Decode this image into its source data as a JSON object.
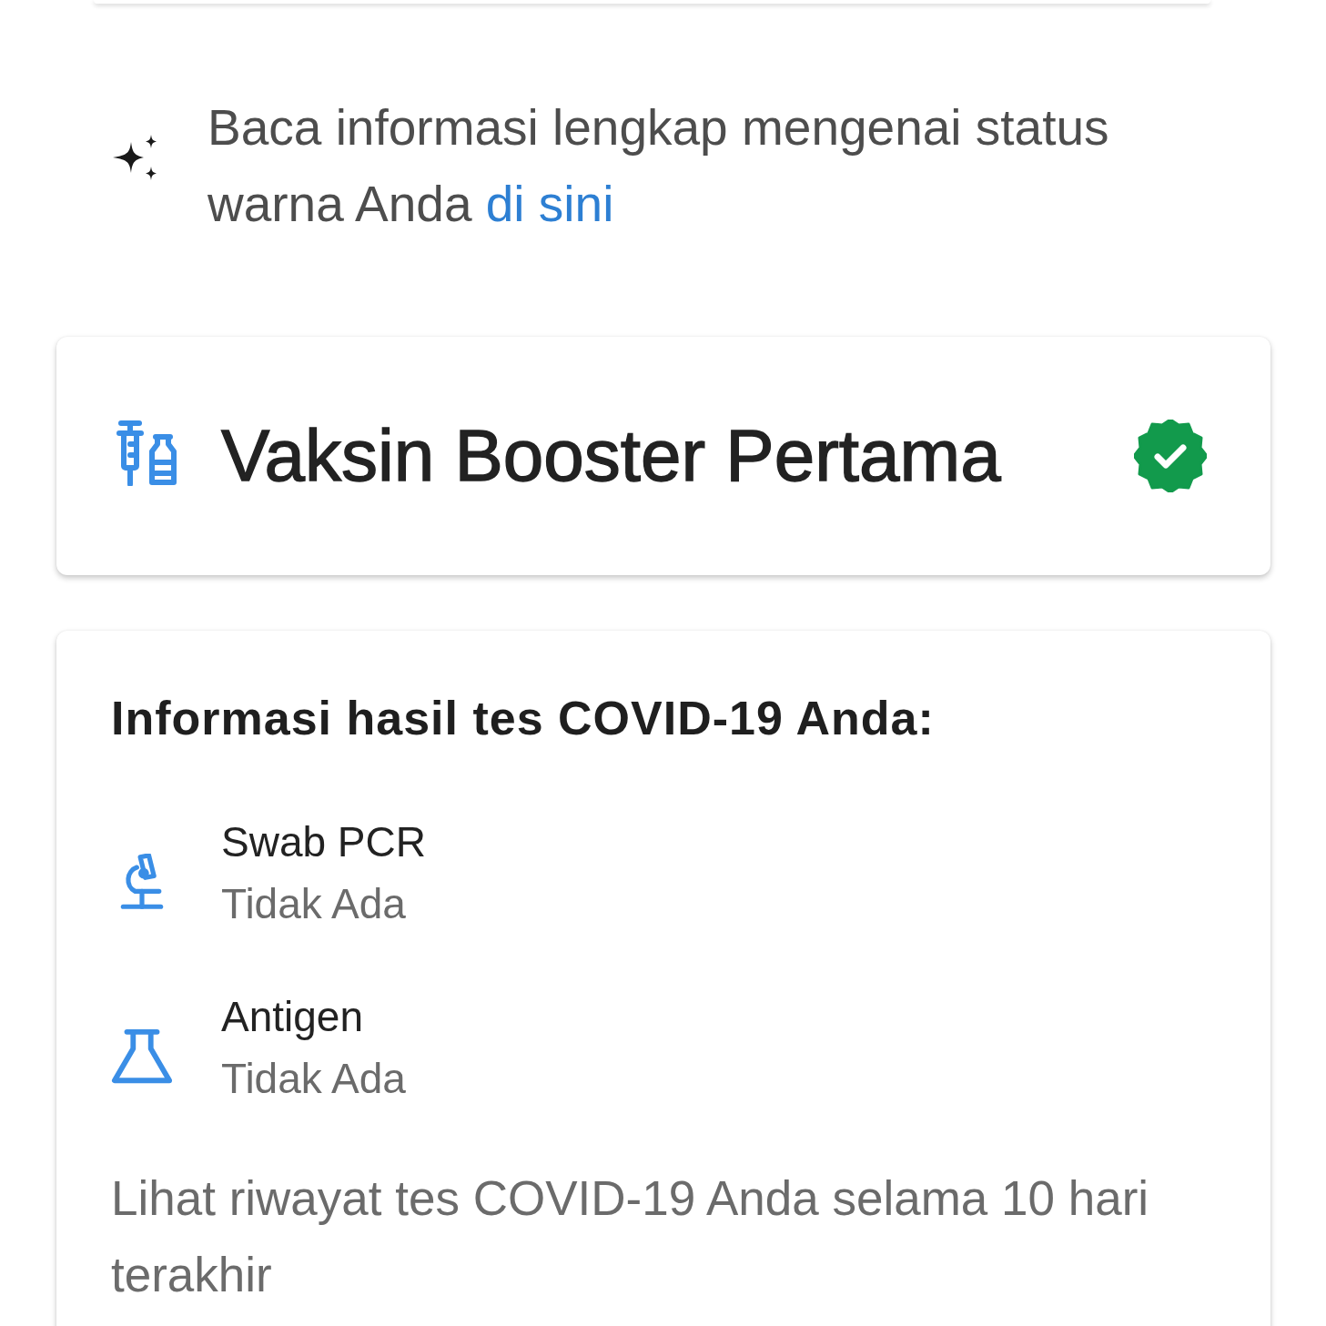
{
  "info": {
    "text": "Baca informasi lengkap mengenai status warna Anda ",
    "link": "di sini"
  },
  "vaccine_card": {
    "title": "Vaksin Booster Pertama",
    "verified": true
  },
  "test_card": {
    "heading": "Informasi hasil tes COVID-19 Anda:",
    "tests": [
      {
        "kind": "pcr",
        "name": "Swab PCR",
        "result": "Tidak Ada"
      },
      {
        "kind": "antigen",
        "name": "Antigen",
        "result": "Tidak Ada"
      }
    ],
    "history_text": "Lihat riwayat tes COVID-19 Anda selama 10 hari terakhir"
  }
}
